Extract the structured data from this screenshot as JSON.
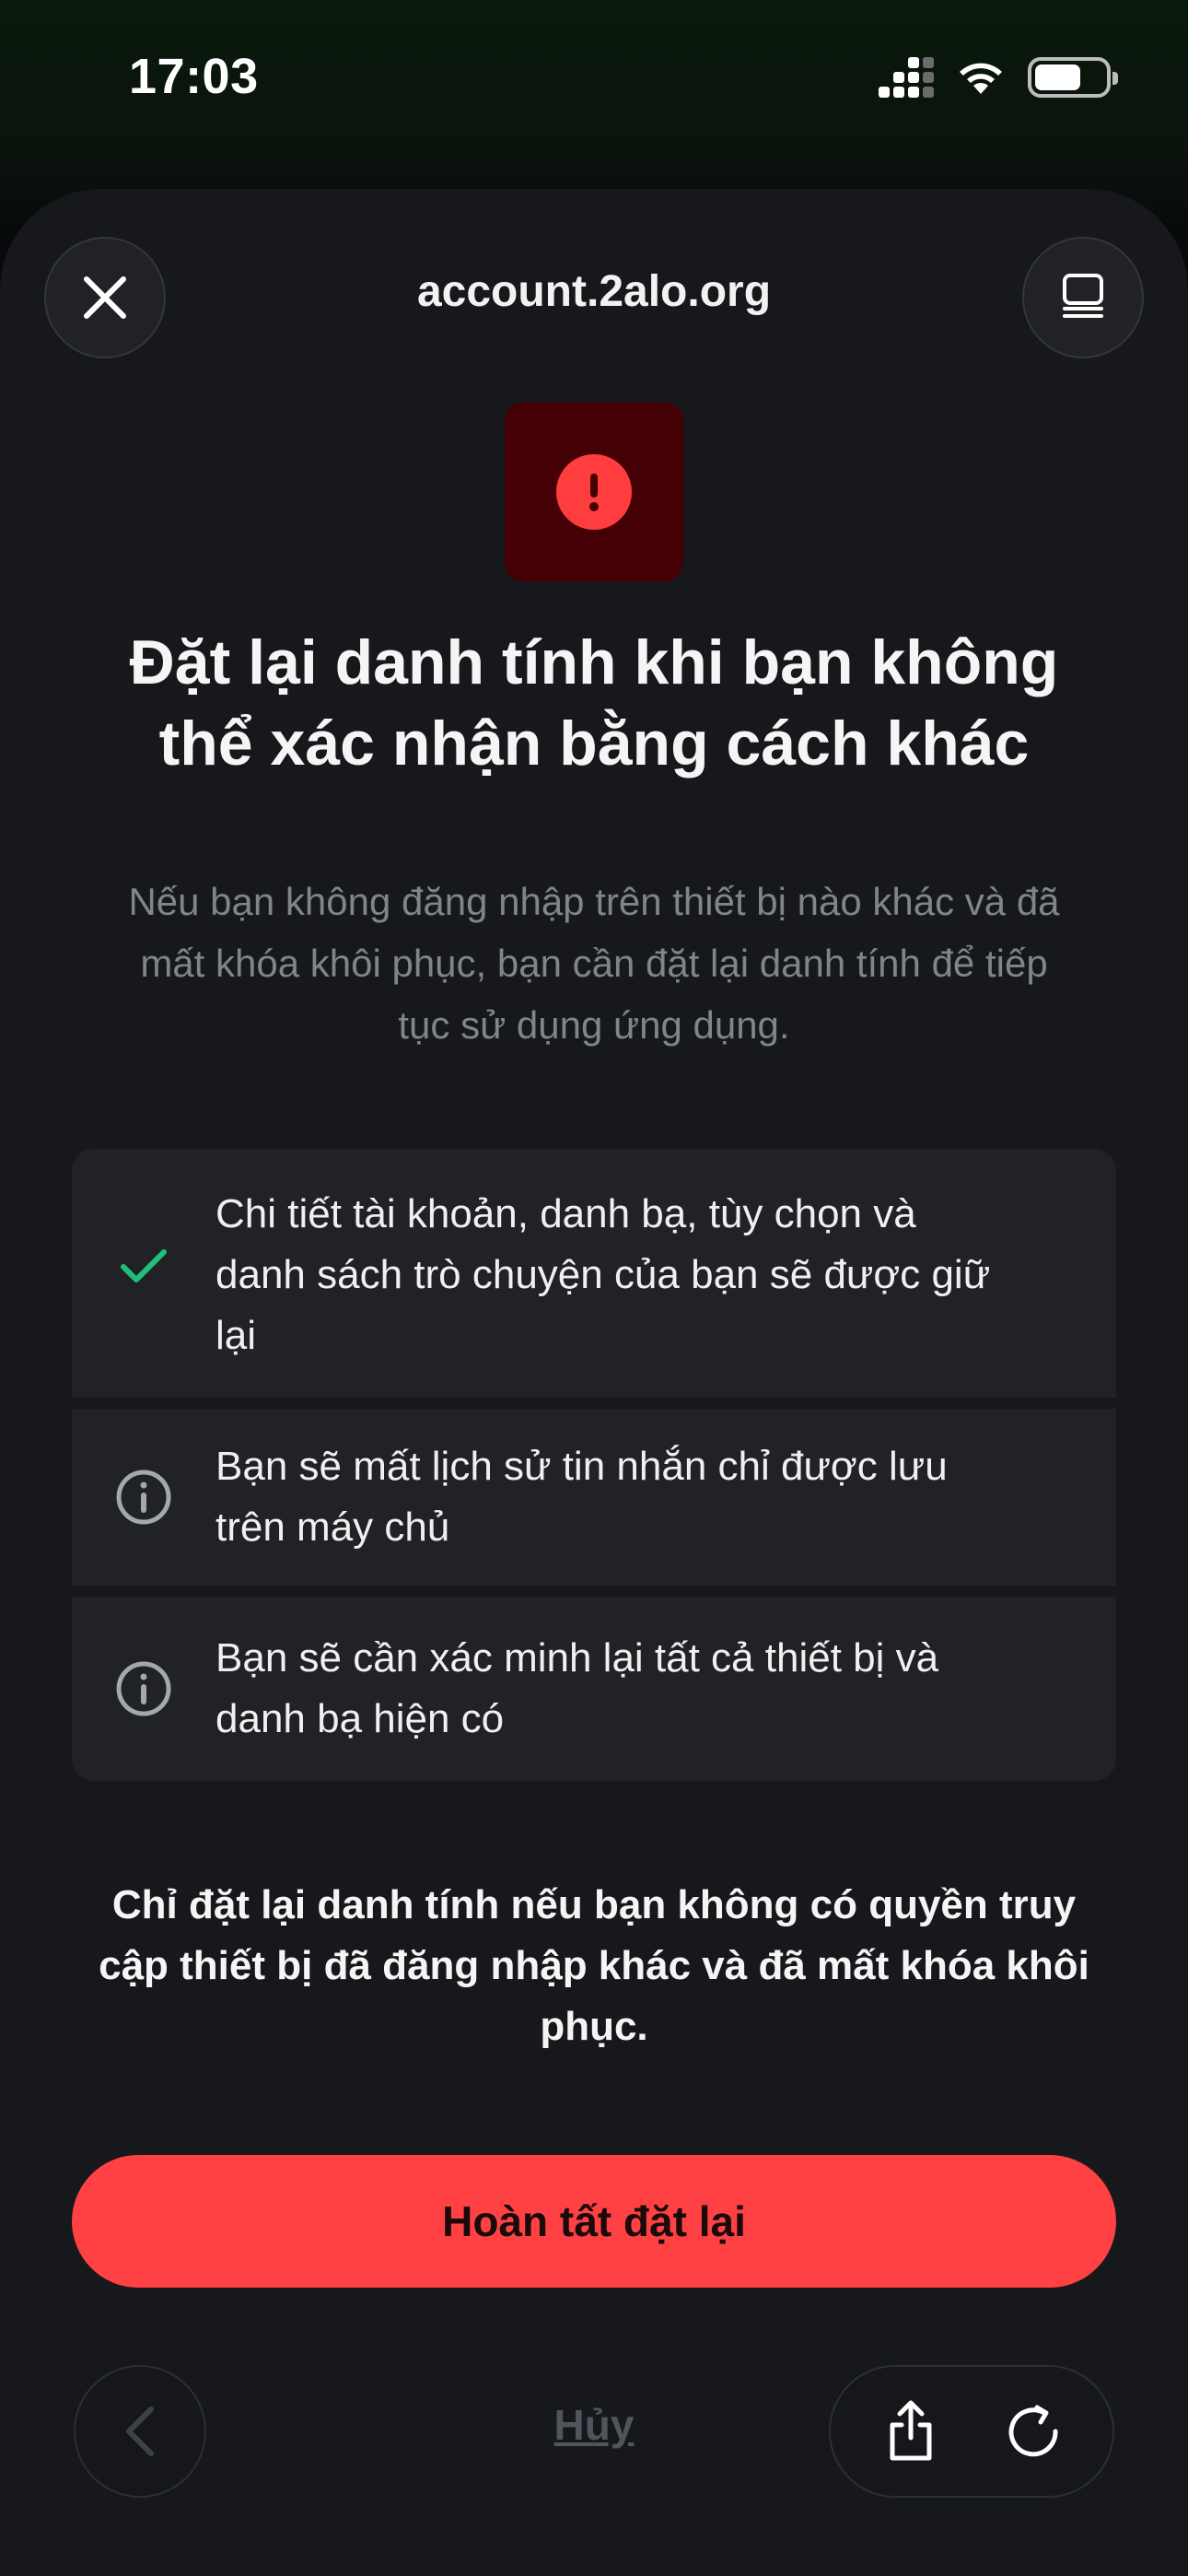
{
  "status_bar": {
    "time": "17:03",
    "icons": [
      "cellular-signal-icon",
      "wifi-icon",
      "battery-icon"
    ],
    "battery_level": 0.66
  },
  "header": {
    "domain": "account.2alo.org",
    "close_icon": "close-icon",
    "tabs_icon": "tabs-icon"
  },
  "content": {
    "alert_icon": "exclamation-icon",
    "title_line1": "Đặt lại danh tính khi bạn không",
    "title_line2": "thể xác nhận bằng cách khác",
    "subtitle_line1": "Nếu bạn không đăng nhập trên thiết bị nào khác và đã",
    "subtitle_line2": "mất khóa khôi phục, bạn cần đặt lại danh tính để tiếp",
    "subtitle_line3": "tục sử dụng ứng dụng.",
    "items": [
      {
        "icon": "checkmark-icon",
        "line1": "Chi tiết tài khoản, danh bạ, tùy chọn và",
        "line2": "danh sách trò chuyện của bạn sẽ được giữ",
        "line3": "lại"
      },
      {
        "icon": "info-icon",
        "line1": "Bạn sẽ mất lịch sử tin nhắn chỉ được lưu",
        "line2": "trên máy chủ"
      },
      {
        "icon": "info-icon",
        "line1": "Bạn sẽ cần xác minh lại tất cả thiết bị và",
        "line2": "danh bạ hiện có"
      }
    ],
    "warning_line1": "Chỉ đặt lại danh tính nếu bạn không có quyền truy",
    "warning_line2": "cập thiết bị đã đăng nhập khác và đã mất khóa khôi",
    "warning_line3": "phục.",
    "primary_button": "Hoàn tất đặt lại"
  },
  "bottom_bar": {
    "cancel_label": "Hủy",
    "back_icon": "chevron-left-icon",
    "share_icon": "share-icon",
    "reload_icon": "reload-icon"
  },
  "colors": {
    "accent": "#ff4143",
    "success": "#1fbf7a",
    "alert_bg": "#450006",
    "sheet_bg": "#16181c"
  }
}
